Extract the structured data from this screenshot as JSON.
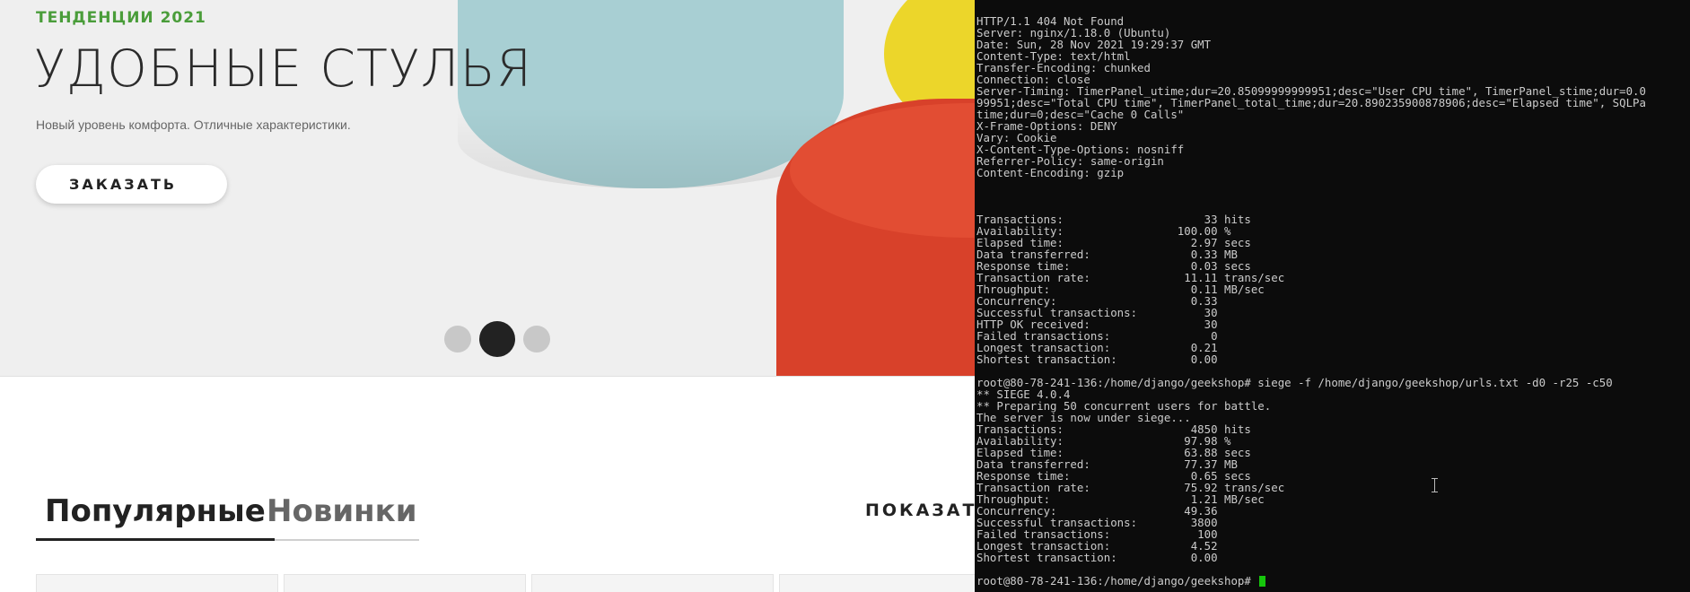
{
  "website": {
    "hero": {
      "tag": "ТЕНДЕНЦИИ 2021",
      "title": "УДОБНЫЕ СТУЛЬЯ",
      "subtitle": "Новый уровень комфорта. Отличные характеристики.",
      "order_button": "ЗАКАЗАТЬ",
      "slider": {
        "total": 3,
        "active_index": 2
      }
    },
    "tabs": [
      {
        "label": "Популярные",
        "active": true
      },
      {
        "label": "Новинки",
        "active": false
      }
    ],
    "show_link": "ПОКАЗАТЬ",
    "colors": {
      "accent_green": "#4a9d3a",
      "stool_blue": "#a8cfd3",
      "stool_red": "#d8412a",
      "stool_yellow": "#ecd62a"
    }
  },
  "terminal": {
    "lines": [
      "HTTP/1.1 404 Not Found",
      "Server: nginx/1.18.0 (Ubuntu)",
      "Date: Sun, 28 Nov 2021 19:29:37 GMT",
      "Content-Type: text/html",
      "Transfer-Encoding: chunked",
      "Connection: close",
      "Server-Timing: TimerPanel_utime;dur=20.85099999999951;desc=\"User CPU time\", TimerPanel_stime;dur=0.0",
      "99951;desc=\"Total CPU time\", TimerPanel_total_time;dur=20.890235900878906;desc=\"Elapsed time\", SQLPa",
      "time;dur=0;desc=\"Cache 0 Calls\"",
      "X-Frame-Options: DENY",
      "Vary: Cookie",
      "X-Content-Type-Options: nosniff",
      "Referrer-Policy: same-origin",
      "Content-Encoding: gzip",
      "",
      "",
      "",
      "Transactions:                     33 hits",
      "Availability:                 100.00 %",
      "Elapsed time:                   2.97 secs",
      "Data transferred:               0.33 MB",
      "Response time:                  0.03 secs",
      "Transaction rate:              11.11 trans/sec",
      "Throughput:                     0.11 MB/sec",
      "Concurrency:                    0.33",
      "Successful transactions:          30",
      "HTTP OK received:                 30",
      "Failed transactions:               0",
      "Longest transaction:            0.21",
      "Shortest transaction:           0.00",
      "",
      "root@80-78-241-136:/home/django/geekshop# siege -f /home/django/geekshop/urls.txt -d0 -r25 -c50",
      "** SIEGE 4.0.4",
      "** Preparing 50 concurrent users for battle.",
      "The server is now under siege...",
      "Transactions:                   4850 hits",
      "Availability:                  97.98 %",
      "Elapsed time:                  63.88 secs",
      "Data transferred:              77.37 MB",
      "Response time:                  0.65 secs",
      "Transaction rate:              75.92 trans/sec",
      "Throughput:                     1.21 MB/sec",
      "Concurrency:                   49.36",
      "Successful transactions:        3800",
      "Failed transactions:             100",
      "Longest transaction:            4.52",
      "Shortest transaction:           0.00",
      ""
    ],
    "prompt": "root@80-78-241-136:/home/django/geekshop# ",
    "colors": {
      "background": "#0c0c0c",
      "text": "#cccccc",
      "cursor": "#16c60c"
    }
  }
}
